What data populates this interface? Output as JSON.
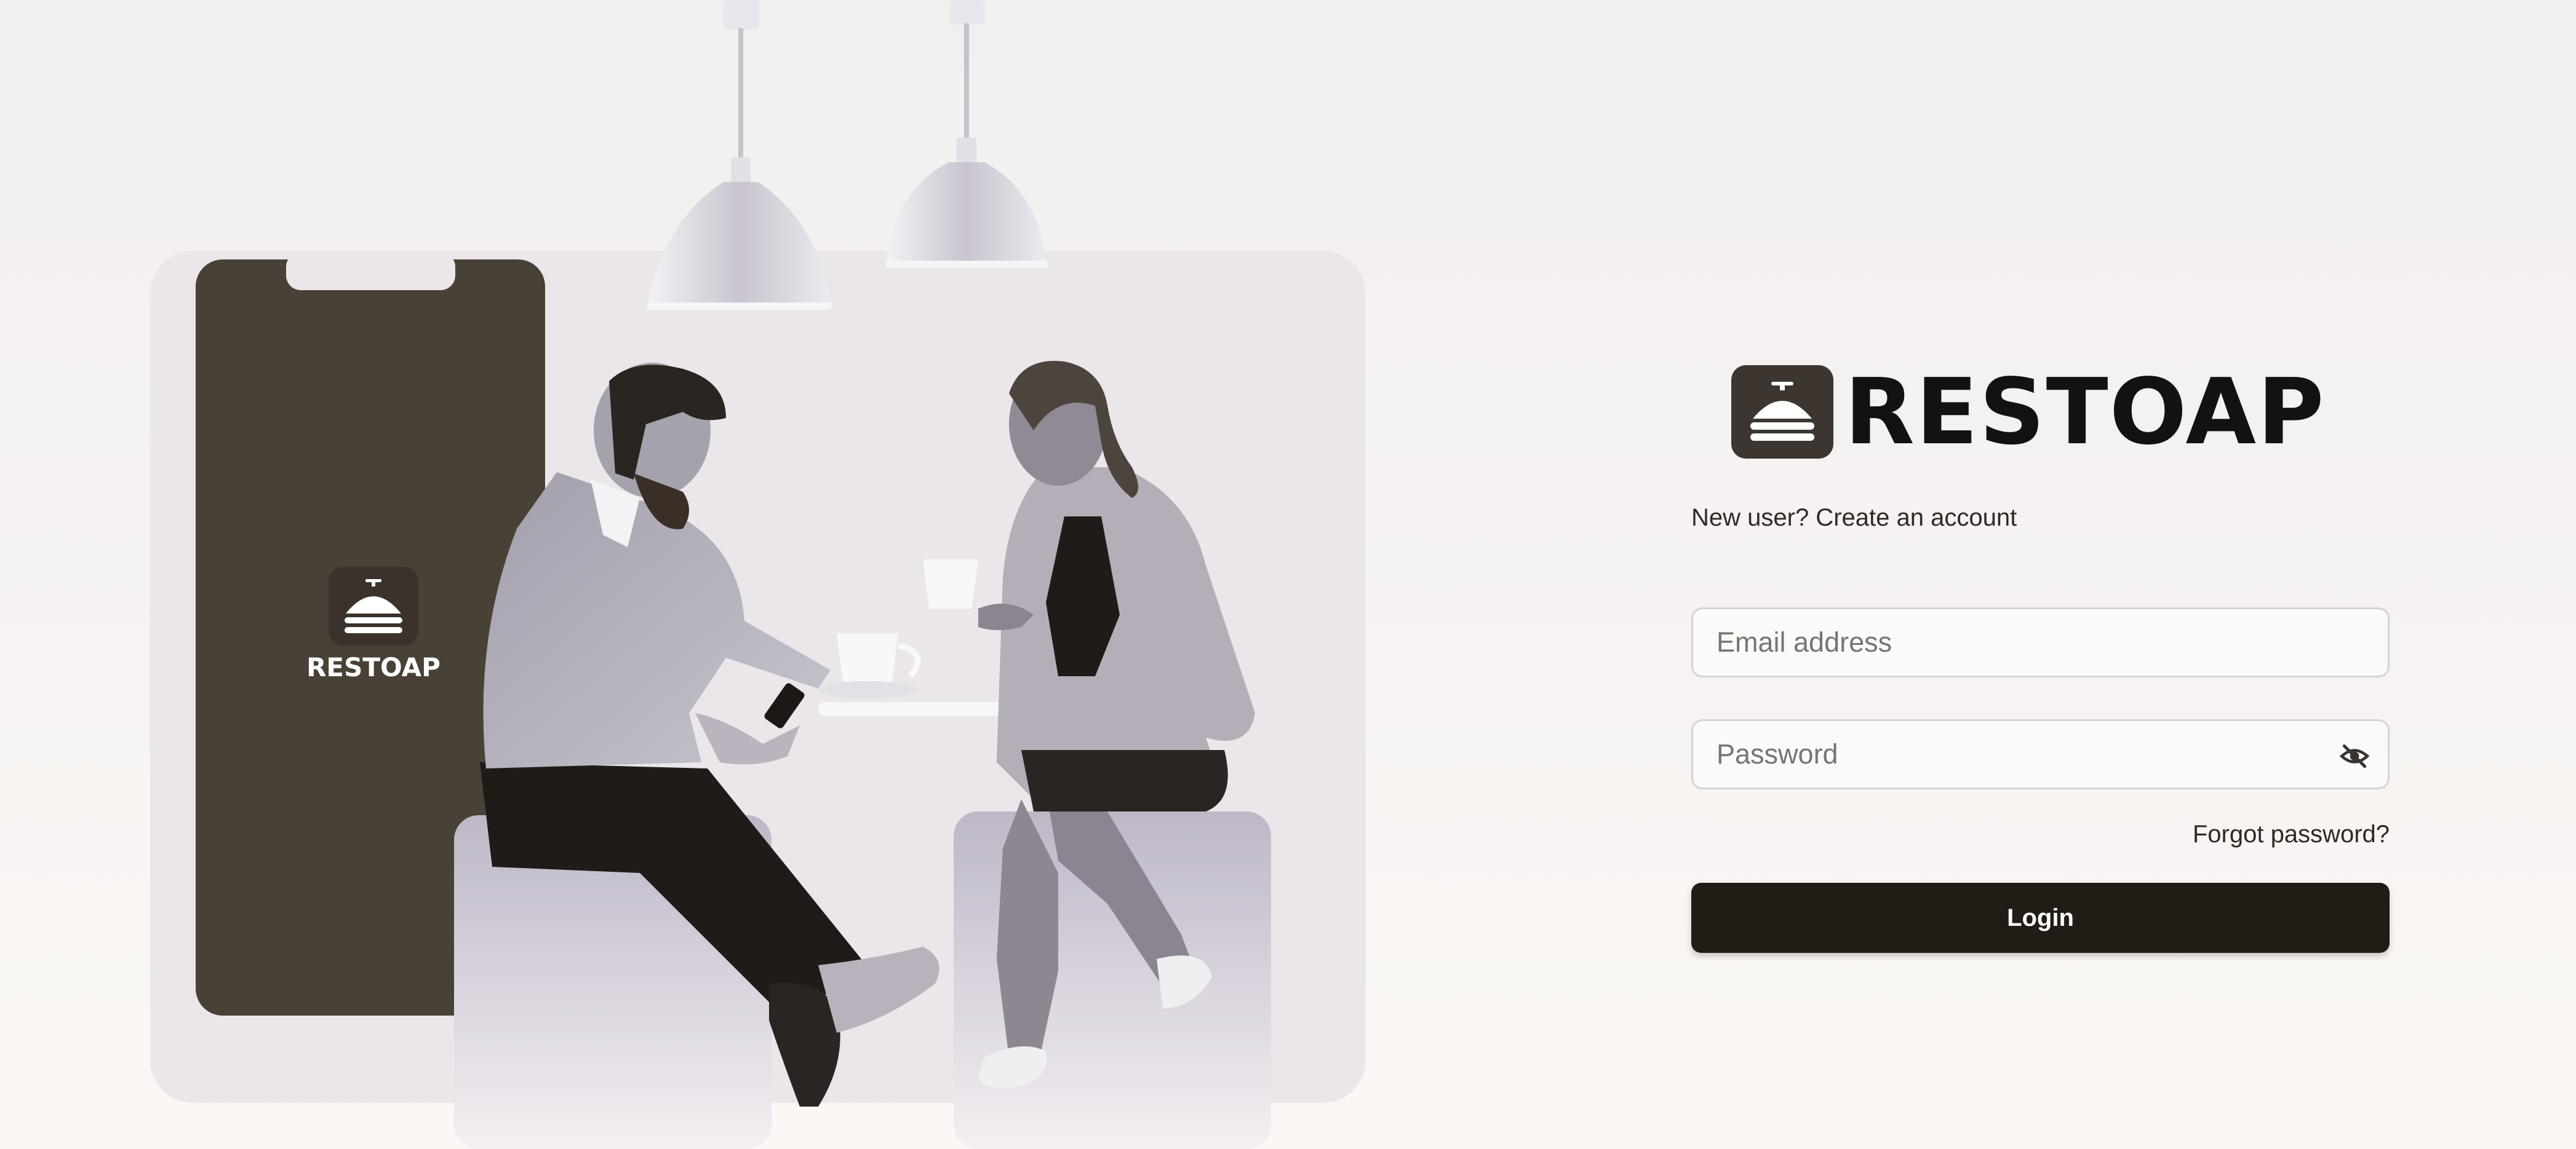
{
  "brand": {
    "name": "RESTOAP",
    "phone_label": "RESTOAP"
  },
  "auth": {
    "new_user_text": "New user? Create an account",
    "email_placeholder": "Email address",
    "password_placeholder": "Password",
    "forgot_label": "Forgot password?",
    "login_label": "Login"
  },
  "icons": {
    "logo": "restaurant-bell-icon",
    "password_toggle": "eye-off-icon"
  },
  "colors": {
    "brand_dark": "#3d3630",
    "button_bg": "#221c17",
    "phone_bg": "#4a4136"
  }
}
